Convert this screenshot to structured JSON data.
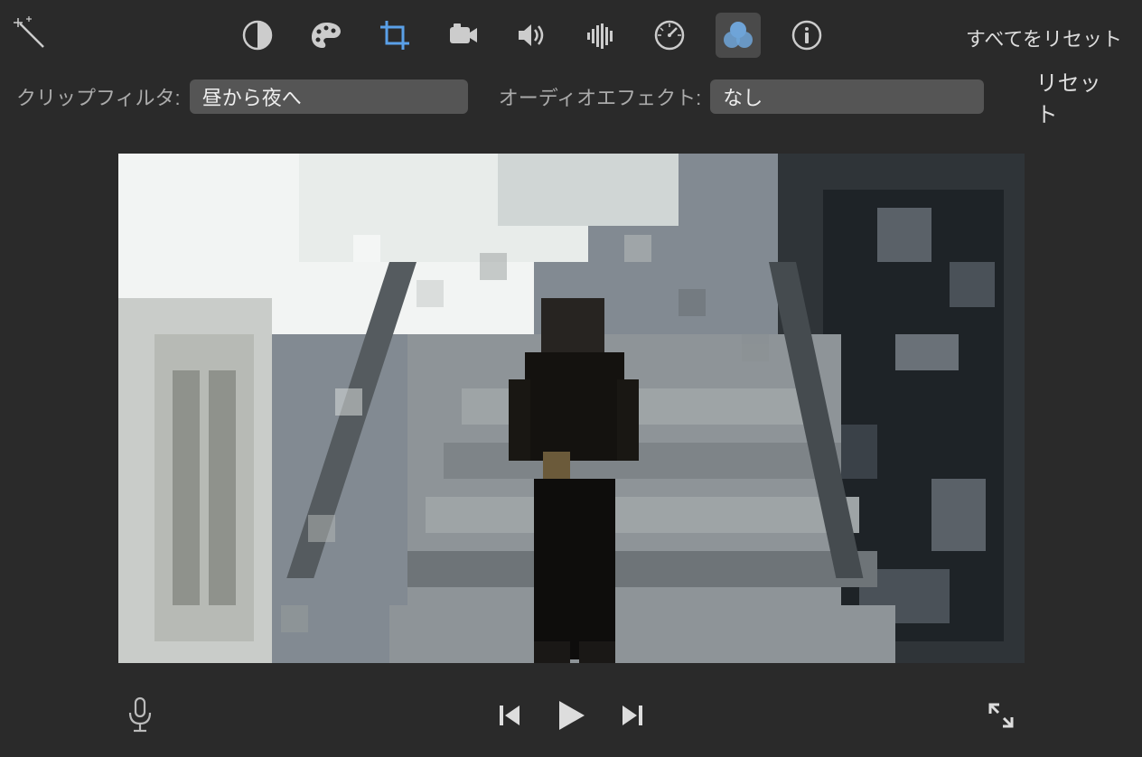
{
  "toolbar": {
    "reset_all_label": "すべてをリセット",
    "icons": {
      "magic_wand": "magic-wand-icon",
      "color_balance": "color-balance-icon",
      "color_correction": "color-palette-icon",
      "crop": "crop-icon",
      "stabilization": "camera-icon",
      "volume": "speaker-icon",
      "noise_reduction": "equalizer-icon",
      "speed": "gauge-icon",
      "filter": "overlap-circles-icon",
      "info": "info-icon"
    },
    "active_tool": "filter",
    "highlighted_tool": "crop"
  },
  "filters": {
    "clip_filter_label": "クリップフィルタ:",
    "clip_filter_value": "昼から夜へ",
    "audio_effect_label": "オーディオエフェクト:",
    "audio_effect_value": "なし",
    "reset_label": "リセット"
  },
  "playback": {
    "mic": "microphone-icon",
    "prev": "skip-back-icon",
    "play": "play-icon",
    "next": "skip-forward-icon",
    "fullscreen": "expand-icon"
  }
}
